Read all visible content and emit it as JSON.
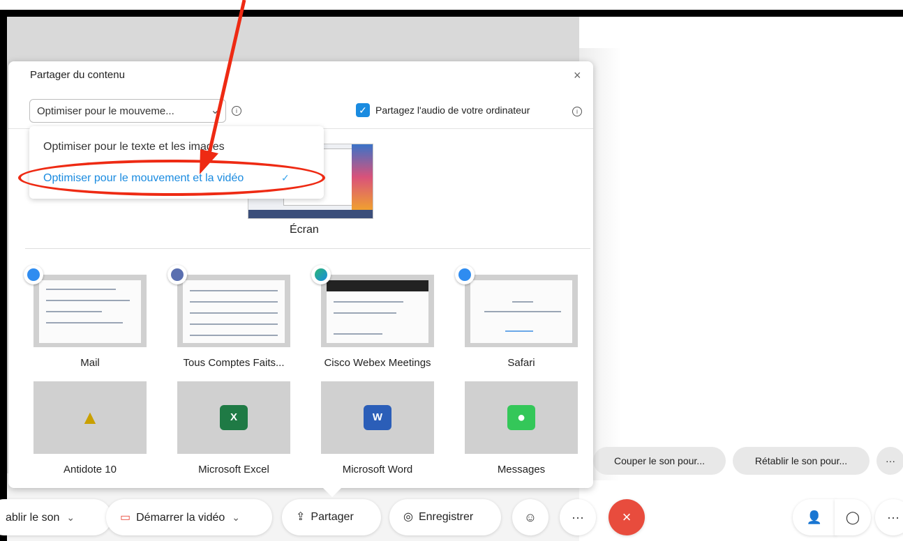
{
  "dialog": {
    "title": "Partager du contenu",
    "close_icon": "×",
    "optimize_value": "Optimiser pour le mouveme...",
    "audio_label": "Partagez l'audio de votre ordinateur",
    "audio_checked": true,
    "info_glyph": "i"
  },
  "dropdown": {
    "options": [
      {
        "label": "Optimiser pour le texte et les images",
        "selected": false
      },
      {
        "label": "Optimiser pour le mouvement et la vidéo",
        "selected": true
      }
    ],
    "check_glyph": "✓"
  },
  "screen": {
    "label": "Écran"
  },
  "apps": [
    {
      "label": "Mail",
      "icon": "mail-icon"
    },
    {
      "label": "Tous Comptes Faits...",
      "icon": "tous-comptes-faits-icon"
    },
    {
      "label": "Cisco Webex Meetings",
      "icon": "webex-icon"
    },
    {
      "label": "Safari",
      "icon": "safari-icon"
    },
    {
      "label": "Antidote 10",
      "icon": "antidote-icon",
      "glyph": "▲"
    },
    {
      "label": "Microsoft Excel",
      "icon": "excel-icon",
      "glyph": "X"
    },
    {
      "label": "Microsoft Word",
      "icon": "word-icon",
      "glyph": "W"
    },
    {
      "label": "Messages",
      "icon": "messages-icon",
      "glyph": "💬"
    }
  ],
  "side_actions": {
    "mute_all": "Couper le son pour...",
    "unmute_all": "Rétablir le son pour...",
    "more": "···"
  },
  "controls": {
    "unmute": "ablir le son",
    "video_icon": "▭",
    "video": "Démarrer la vidéo",
    "share_icon": "⇪",
    "share": "Partager",
    "record_icon": "◎",
    "record": "Enregistrer",
    "reactions": "☺",
    "more": "···",
    "end": "×",
    "participants": "👤",
    "chat": "◯",
    "more_right": "···",
    "chevron": "⌄"
  },
  "colors": {
    "accent": "#1a8be0",
    "annotation": "#ee2a13",
    "end_call": "#e84c3d"
  }
}
